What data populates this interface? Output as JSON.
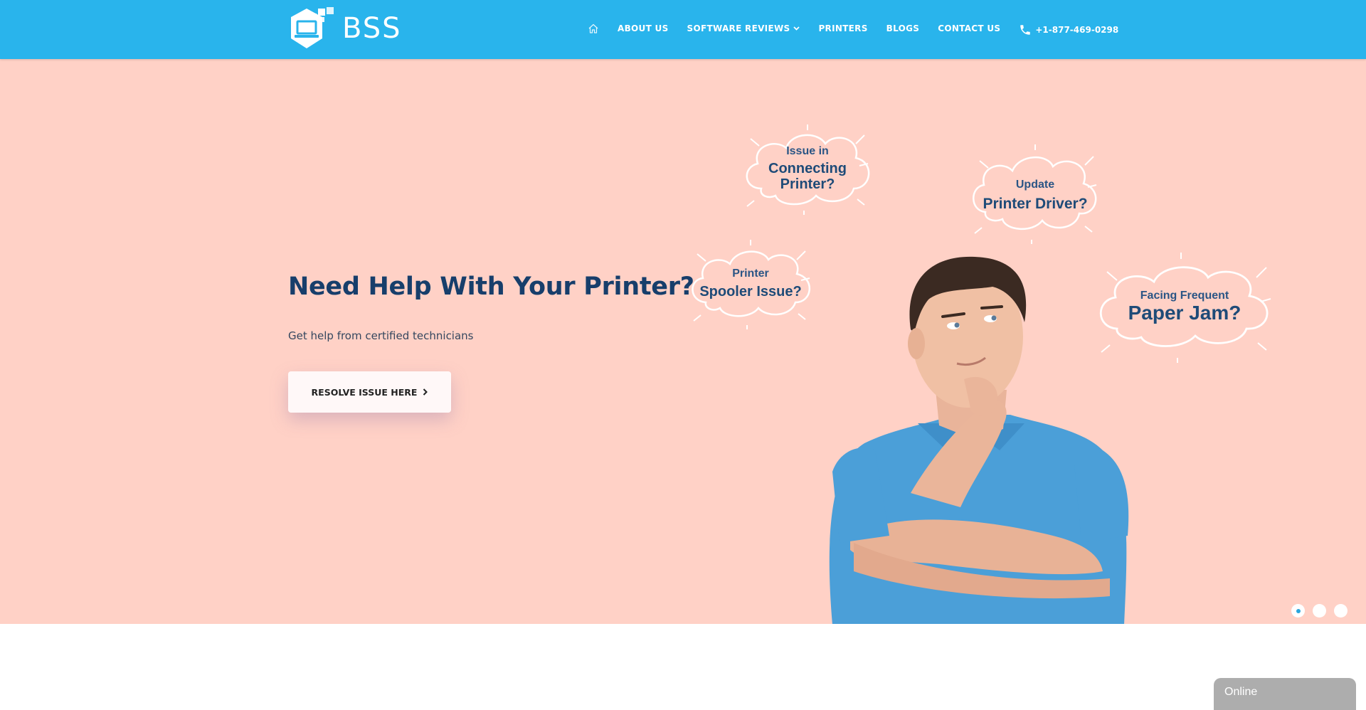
{
  "header": {
    "brand": "BSS",
    "nav": [
      {
        "label": "ABOUT US"
      },
      {
        "label": "SOFTWARE REVIEWS",
        "has_dropdown": true
      },
      {
        "label": "PRINTERS"
      },
      {
        "label": "BLOGS"
      },
      {
        "label": "CONTACT US"
      }
    ],
    "phone": "+1-877-469-0298",
    "icons": {
      "home": "home-icon",
      "phone": "phone-icon",
      "dropdown": "chevron-down-icon"
    }
  },
  "hero": {
    "title": "Need Help With Your Printer?",
    "subtitle": "Get help from certified technicians",
    "cta_label": "RESOLVE ISSUE HERE",
    "bubbles": [
      {
        "small": "Issue in",
        "big": "Connecting Printer?"
      },
      {
        "small": "Update",
        "big": "Printer Driver?"
      },
      {
        "small": "Printer",
        "big": "Spooler Issue?"
      },
      {
        "small": "Facing Frequent",
        "big": "Paper Jam?"
      }
    ],
    "slider": {
      "total": 3,
      "active": 1
    }
  },
  "chat": {
    "status": "Online"
  },
  "colors": {
    "header": "#29b4ec",
    "hero_bg": "#ffd1c6",
    "title": "#173e6b",
    "chat": "#adadad"
  }
}
